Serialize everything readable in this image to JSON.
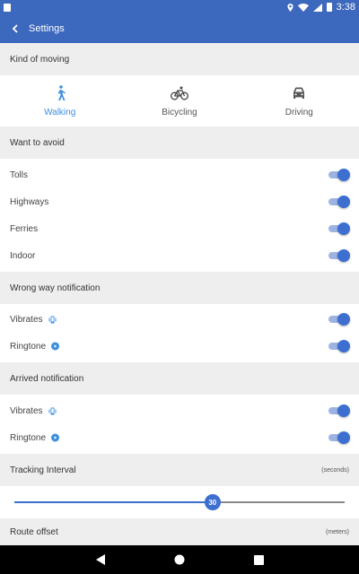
{
  "status_bar": {
    "time": "3:38"
  },
  "app_bar": {
    "title": "Settings"
  },
  "sections": {
    "kind_of_moving": "Kind of moving",
    "want_to_avoid": "Want to avoid",
    "wrong_way": "Wrong way notification",
    "arrived": "Arrived notification",
    "tracking": "Tracking Interval",
    "tracking_unit": "(seconds)",
    "route_offset": "Route offset",
    "route_offset_unit": "(meters)"
  },
  "modes": [
    {
      "label": "Walking",
      "icon": "walking-icon",
      "selected": true
    },
    {
      "label": "Bicycling",
      "icon": "bicycle-icon",
      "selected": false
    },
    {
      "label": "Driving",
      "icon": "car-icon",
      "selected": false
    }
  ],
  "avoid": [
    {
      "label": "Tolls",
      "on": true
    },
    {
      "label": "Highways",
      "on": true
    },
    {
      "label": "Ferries",
      "on": true
    },
    {
      "label": "Indoor",
      "on": true
    }
  ],
  "wrong_way": [
    {
      "label": "Vibrates",
      "icon": "vibrate-icon",
      "on": true
    },
    {
      "label": "Ringtone",
      "icon": "play-icon",
      "on": true
    }
  ],
  "arrived": [
    {
      "label": "Vibrates",
      "icon": "vibrate-icon",
      "on": true
    },
    {
      "label": "Ringtone",
      "icon": "play-icon",
      "on": true
    }
  ],
  "tracking_slider": {
    "value": "30",
    "fraction": 0.6
  },
  "colors": {
    "primary": "#3c68bd",
    "accent": "#3c6fd0",
    "active_text": "#3c8fe0"
  }
}
